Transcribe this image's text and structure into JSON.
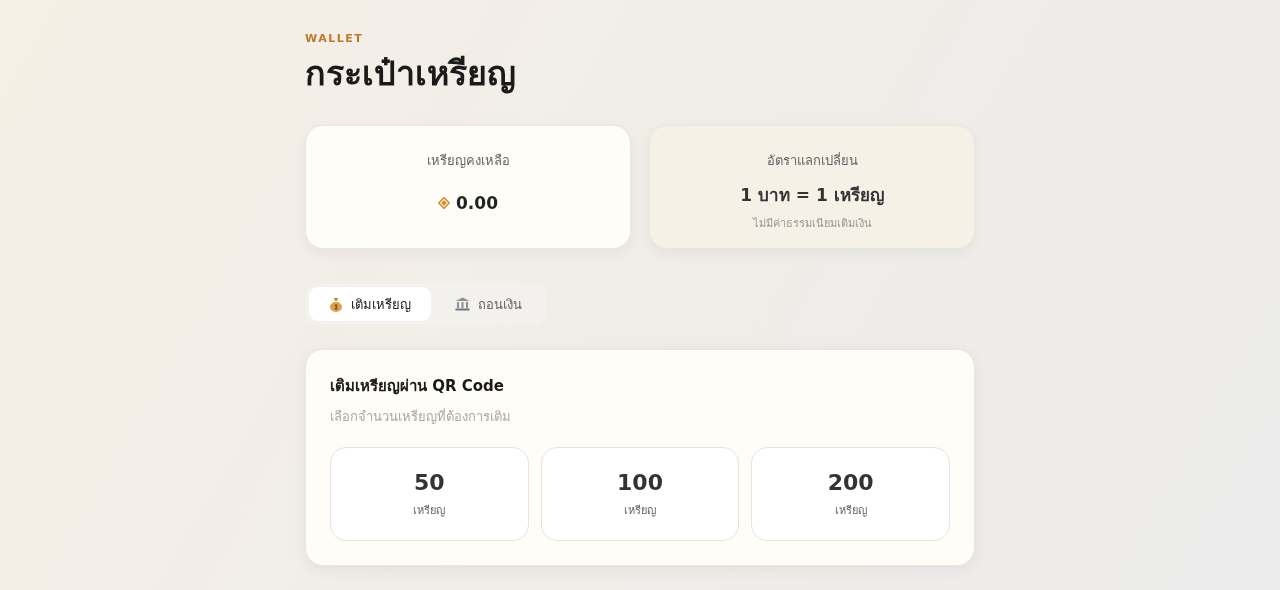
{
  "eyebrow": "WALLET",
  "title": "กระเป๋าเหรียญ",
  "balance": {
    "label": "เหรียญคงเหลือ",
    "value": "0.00"
  },
  "rate": {
    "label": "อัตราแลกเปลี่ยน",
    "value": "1 บาท = 1 เหรียญ",
    "note": "ไม่มีค่าธรรมเนียมเติมเงิน"
  },
  "tabs": [
    {
      "kind": "topup",
      "label": "เติมเหรียญ",
      "selected": true
    },
    {
      "kind": "withdraw",
      "label": "ถอนเงิน",
      "selected": false
    }
  ],
  "panel": {
    "title": "เติมเหรียญผ่าน QR Code",
    "subtitle": "เลือกจำนวนเหรียญที่ต้องการเติม",
    "options": [
      {
        "amount": "50",
        "unit": "เหรียญ"
      },
      {
        "amount": "100",
        "unit": "เหรียญ"
      },
      {
        "amount": "200",
        "unit": "เหรียญ"
      }
    ]
  }
}
